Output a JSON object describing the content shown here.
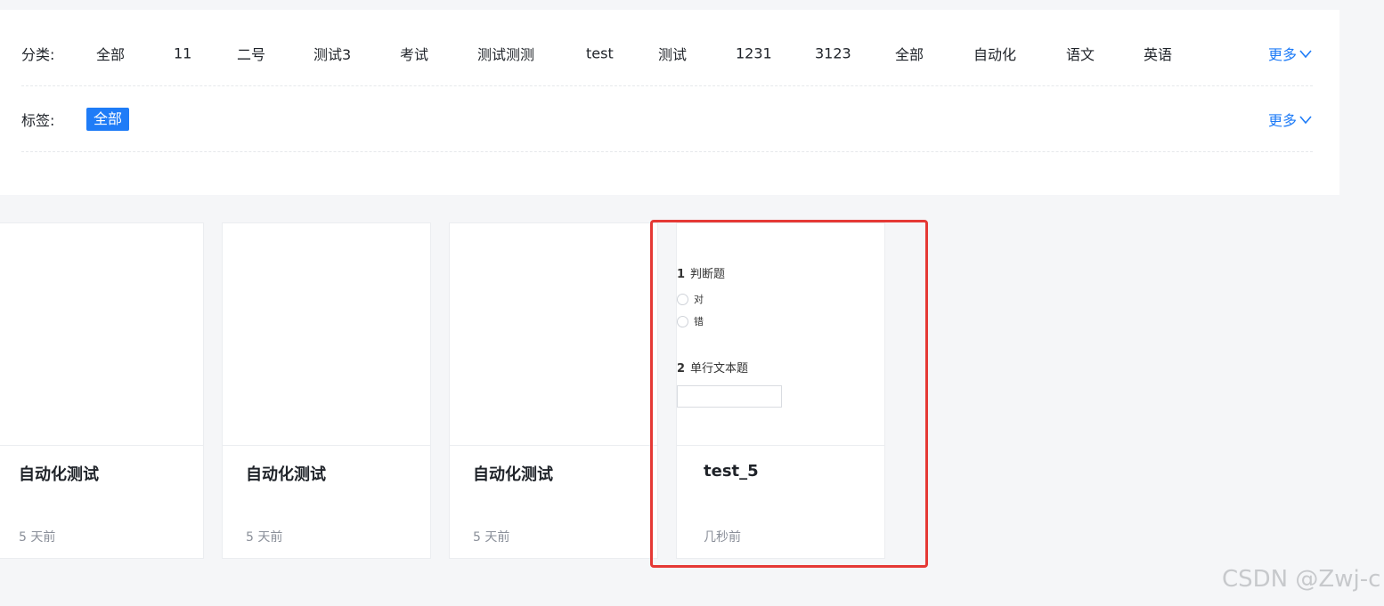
{
  "filters": {
    "category_label": "分类:",
    "categories": [
      "全部",
      "11",
      "二号",
      "测试3",
      "考试",
      "测试测测",
      "test",
      "测试",
      "1231",
      "3123",
      "全部",
      "自动化",
      "语文",
      "英语"
    ],
    "tag_label": "标签:",
    "tag_active": "全部",
    "more_label": "更多",
    "accent_color": "#1f7cf7"
  },
  "cards": [
    {
      "title": "自动化测试",
      "time": "5 天前"
    },
    {
      "title": "自动化测试",
      "time": "5 天前"
    },
    {
      "title": "自动化测试",
      "time": "5 天前"
    },
    {
      "title": "test_5",
      "time": "几秒前"
    }
  ],
  "preview": {
    "q1_num": "1",
    "q1_title": "判断题",
    "q1_options": [
      "对",
      "错"
    ],
    "q2_num": "2",
    "q2_title": "单行文本题"
  },
  "highlight_color": "#e53935",
  "watermark": "CSDN @Zwj-c"
}
